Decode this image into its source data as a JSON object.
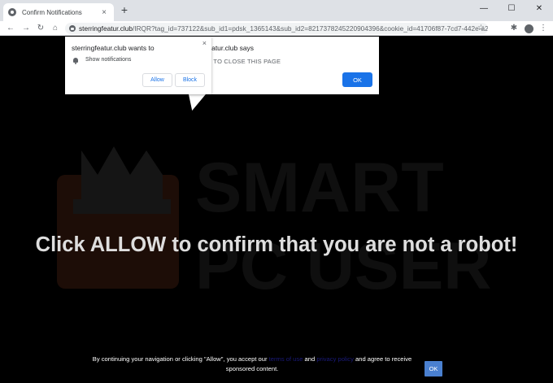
{
  "browser": {
    "tab": {
      "title": "Confirm Notifications",
      "close_glyph": "×",
      "favicon": "globe-icon"
    },
    "new_tab_glyph": "+",
    "window_controls": {
      "minimize": "—",
      "maximize": "☐",
      "close": "✕"
    },
    "nav": {
      "back": "←",
      "forward": "→",
      "reload": "↻",
      "home": "⌂"
    },
    "url": {
      "host": "sterringfeatur.club",
      "path": "/IRQR?tag_id=737122&sub_id1=pdsk_1365143&sub_id2=8217378245220904396&cookie_id=41706f87-7cd7-442e-a2..."
    },
    "toolbar_icons": {
      "star": "☆",
      "extensions": "✱",
      "menu": "⋮"
    }
  },
  "alert_dialog": {
    "title": "featur.club says",
    "message": "W TO CLOSE THIS PAGE",
    "ok_label": "OK"
  },
  "permission_popup": {
    "title": "sterringfeatur.club wants to",
    "close_glyph": "×",
    "permission_label": "Show notifications",
    "allow_label": "Allow",
    "block_label": "Block"
  },
  "page": {
    "headline": "Click ALLOW to confirm that you are not a robot!",
    "watermark": {
      "line1": "SMART",
      "line2": "PC USER"
    },
    "consent": {
      "before": "By continuing your navigation or clicking \"Allow\", you accept our ",
      "terms_link": "terms of use",
      "and": " and ",
      "privacy_link": "privacy policy",
      "after": " and agree to receive sponsored content.",
      "ok_label": "OK"
    }
  },
  "colors": {
    "accent": "#1a73e8",
    "page_bg": "#000000",
    "headline": "#dedede",
    "consent_ok": "#4a80d0"
  }
}
